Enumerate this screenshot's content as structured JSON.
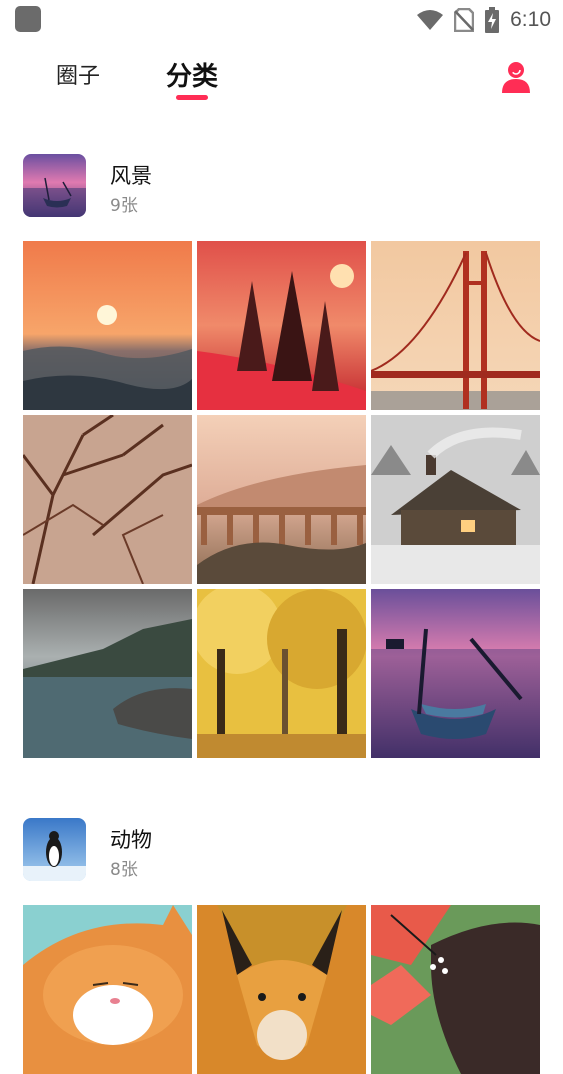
{
  "status_bar": {
    "time": "6:10"
  },
  "tabs": [
    {
      "label": "圈子"
    },
    {
      "label": "分类"
    }
  ],
  "sections": [
    {
      "title": "风景",
      "count": "9张"
    },
    {
      "title": "动物",
      "count": "8张"
    }
  ],
  "colors": {
    "accent": "#ff2d55"
  },
  "icons": [
    "app-icon",
    "wifi-icon",
    "no-sim-icon",
    "battery-charging-icon",
    "profile-icon"
  ]
}
